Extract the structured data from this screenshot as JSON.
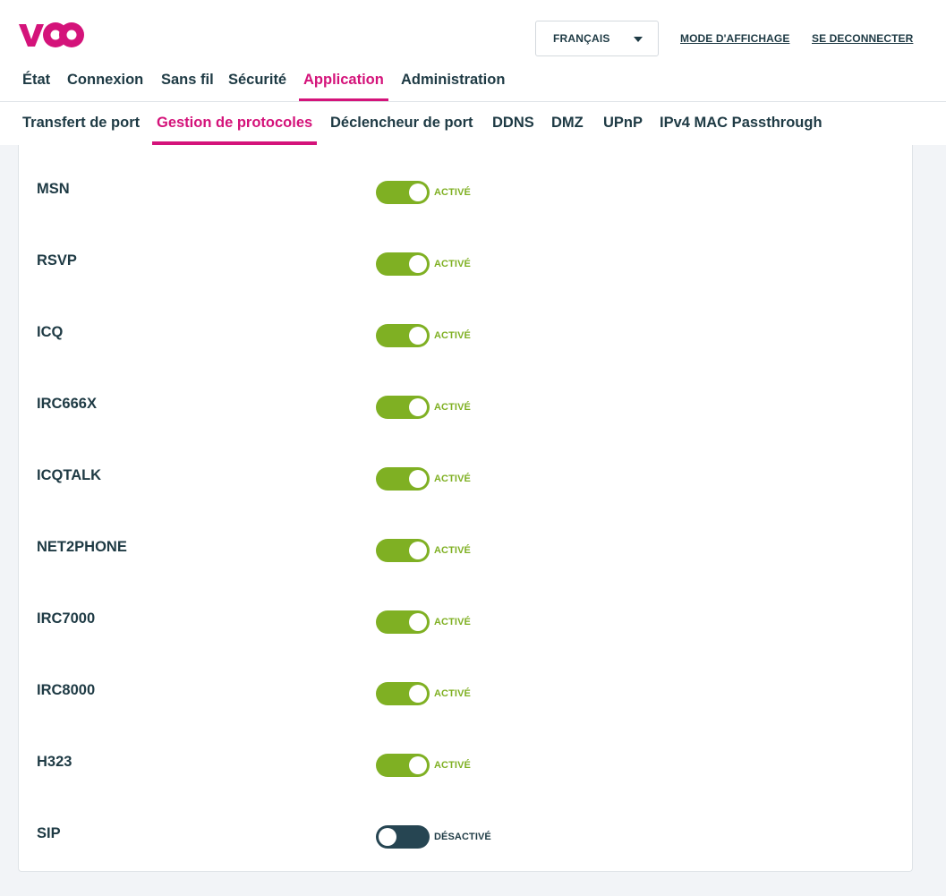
{
  "colors": {
    "brand": "#d4137a",
    "text": "#1e3a44",
    "toggle_on": "#7fb023",
    "toggle_off": "#264552"
  },
  "logo": {
    "text": "voo"
  },
  "header": {
    "language_selected": "FRANÇAIS",
    "display_mode_link": "MODE D'AFFICHAGE",
    "logout_link": "SE DECONNECTER"
  },
  "main_nav": {
    "items": [
      {
        "label": "État",
        "active": false
      },
      {
        "label": "Connexion",
        "active": false
      },
      {
        "label": "Sans fil",
        "active": false
      },
      {
        "label": "Sécurité",
        "active": false
      },
      {
        "label": "Application",
        "active": true
      },
      {
        "label": "Administration",
        "active": false
      }
    ]
  },
  "sub_nav": {
    "items": [
      {
        "label": "Transfert de port",
        "active": false
      },
      {
        "label": "Gestion de protocoles",
        "active": true
      },
      {
        "label": "Déclencheur de port",
        "active": false
      },
      {
        "label": "DDNS",
        "active": false
      },
      {
        "label": "DMZ",
        "active": false
      },
      {
        "label": "UPnP",
        "active": false
      },
      {
        "label": "IPv4 MAC Passthrough",
        "active": false
      }
    ]
  },
  "protocols": [
    {
      "name": "MSN",
      "enabled": true,
      "state_label": "ACTIVÉ"
    },
    {
      "name": "RSVP",
      "enabled": true,
      "state_label": "ACTIVÉ"
    },
    {
      "name": "ICQ",
      "enabled": true,
      "state_label": "ACTIVÉ"
    },
    {
      "name": "IRC666X",
      "enabled": true,
      "state_label": "ACTIVÉ"
    },
    {
      "name": "ICQTALK",
      "enabled": true,
      "state_label": "ACTIVÉ"
    },
    {
      "name": "NET2PHONE",
      "enabled": true,
      "state_label": "ACTIVÉ"
    },
    {
      "name": "IRC7000",
      "enabled": true,
      "state_label": "ACTIVÉ"
    },
    {
      "name": "IRC8000",
      "enabled": true,
      "state_label": "ACTIVÉ"
    },
    {
      "name": "H323",
      "enabled": true,
      "state_label": "ACTIVÉ"
    },
    {
      "name": "SIP",
      "enabled": false,
      "state_label": "DÉSACTIVÉ"
    }
  ]
}
